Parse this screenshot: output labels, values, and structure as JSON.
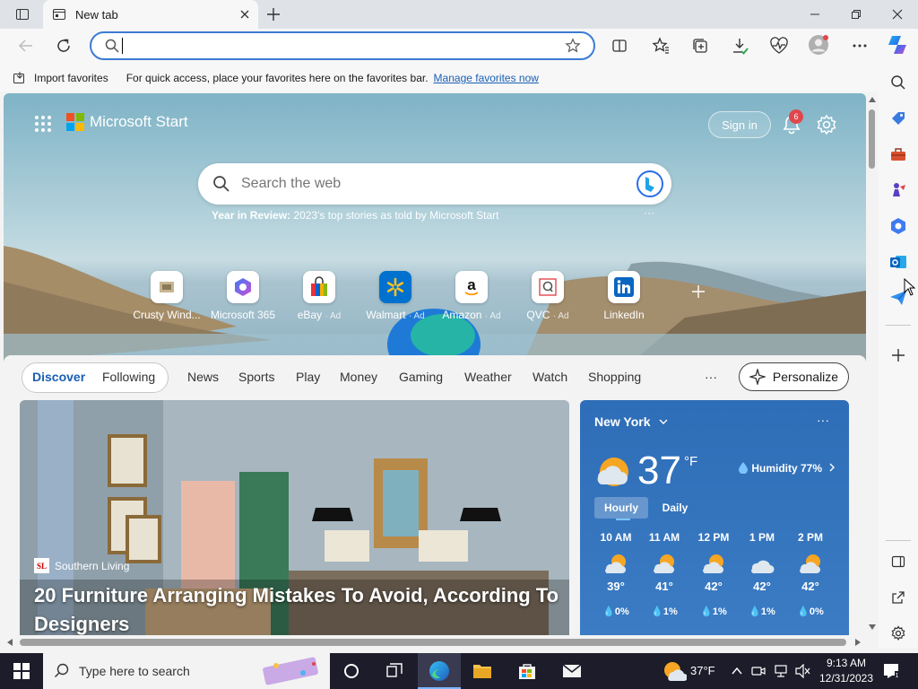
{
  "tab": {
    "title": "New tab"
  },
  "address": {
    "value": "",
    "placeholder": ""
  },
  "favbar": {
    "import_label": "Import favorites",
    "message": "For quick access, place your favorites here on the favorites bar.",
    "manage_link": "Manage favorites now"
  },
  "hero": {
    "brand": "Microsoft Start",
    "sign_in": "Sign in",
    "notifications": "6",
    "search_placeholder": "Search the web",
    "year_bold": "Year in Review:",
    "year_text": "2023's top stories as told by Microsoft Start",
    "more": "···"
  },
  "quicklinks": [
    {
      "label": "Crusty Wind...",
      "ad": ""
    },
    {
      "label": "Microsoft 365",
      "ad": ""
    },
    {
      "label": "eBay",
      "ad": "· Ad"
    },
    {
      "label": "Walmart",
      "ad": "· Ad"
    },
    {
      "label": "Amazon",
      "ad": "· Ad"
    },
    {
      "label": "QVC",
      "ad": "· Ad"
    },
    {
      "label": "LinkedIn",
      "ad": ""
    }
  ],
  "feednav": {
    "discover": "Discover",
    "following": "Following",
    "items": [
      "News",
      "Sports",
      "Play",
      "Money",
      "Gaming",
      "Weather",
      "Watch",
      "Shopping"
    ],
    "more": "···",
    "personalize": "Personalize"
  },
  "article": {
    "source_logo": "SL",
    "source": "Southern Living",
    "headline": "20 Furniture Arranging Mistakes To Avoid, According To Designers"
  },
  "weather": {
    "city": "New York",
    "temp": "37",
    "unit": "°F",
    "humidity": "Humidity 77%",
    "hourly_tab": "Hourly",
    "daily_tab": "Daily",
    "more": "···",
    "hours": [
      {
        "time": "10 AM",
        "temp": "39°",
        "precip": "0%",
        "icon": "partly-sunny"
      },
      {
        "time": "11 AM",
        "temp": "41°",
        "precip": "1%",
        "icon": "partly-sunny"
      },
      {
        "time": "12 PM",
        "temp": "42°",
        "precip": "1%",
        "icon": "partly-sunny"
      },
      {
        "time": "1 PM",
        "temp": "42°",
        "precip": "1%",
        "icon": "cloudy"
      },
      {
        "time": "2 PM",
        "temp": "42°",
        "precip": "0%",
        "icon": "partly-sunny"
      }
    ]
  },
  "taskbar": {
    "search_placeholder": "Type here to search",
    "weather_temp": "37°F",
    "time": "9:13 AM",
    "date": "12/31/2023"
  },
  "colors": {
    "accent": "#3b7bd4",
    "weather_bg": "#2e6db7",
    "taskbar": "#1c1c2a"
  }
}
